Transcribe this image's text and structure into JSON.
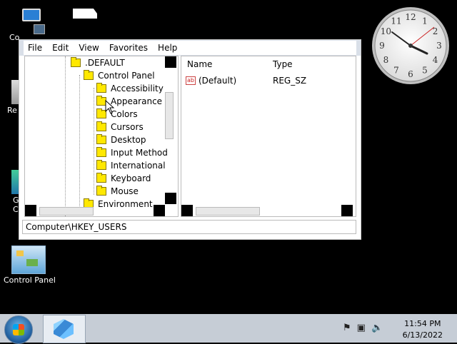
{
  "desktop": {
    "icons": [
      {
        "label": "Co"
      },
      {
        "label": "Re"
      },
      {
        "label": "G\nC"
      },
      {
        "label": "Control Panel"
      }
    ]
  },
  "window": {
    "menu": [
      "File",
      "Edit",
      "View",
      "Favorites",
      "Help"
    ],
    "tree": [
      {
        "label": ".DEFAULT"
      },
      {
        "label": "Control Panel"
      },
      {
        "label": "Accessibility"
      },
      {
        "label": "Appearance"
      },
      {
        "label": "Colors"
      },
      {
        "label": "Cursors"
      },
      {
        "label": "Desktop"
      },
      {
        "label": "Input Method"
      },
      {
        "label": "International"
      },
      {
        "label": "Keyboard"
      },
      {
        "label": "Mouse"
      },
      {
        "label": "Environment"
      }
    ],
    "list": {
      "columns": [
        "Name",
        "Type"
      ],
      "rows": [
        {
          "name": "(Default)",
          "type": "REG_SZ",
          "icon": "ab"
        }
      ]
    },
    "status": "Computer\\HKEY_USERS"
  },
  "clock_numbers": [
    "12",
    "1",
    "2",
    "3",
    "4",
    "5",
    "6",
    "7",
    "8",
    "9",
    "10",
    "11"
  ],
  "taskbar": {
    "time": "11:54 PM",
    "date": "6/13/2022"
  },
  "colors": {
    "folder": "#ffe800",
    "taskbar": "#c6cdd6",
    "desktop": "#000000"
  }
}
